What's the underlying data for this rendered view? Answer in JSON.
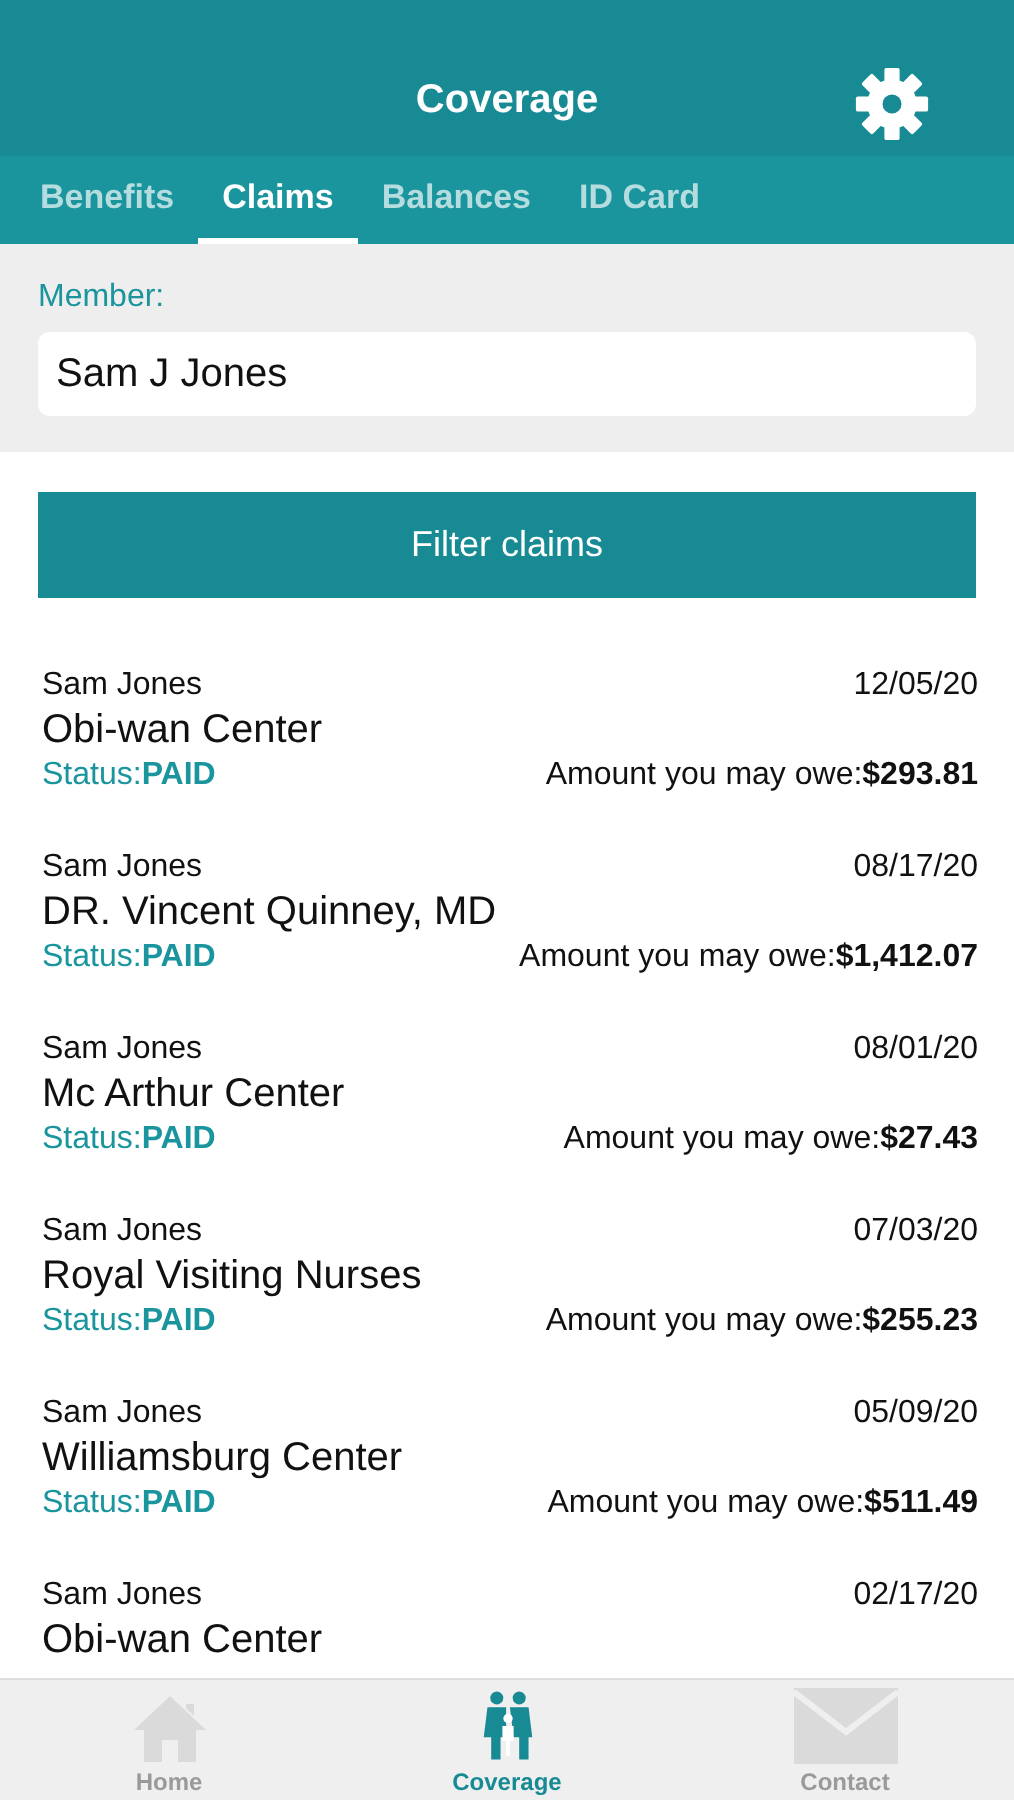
{
  "header": {
    "title": "Coverage"
  },
  "tabs": [
    {
      "label": "Benefits",
      "selected": false
    },
    {
      "label": "Claims",
      "selected": true
    },
    {
      "label": "Balances",
      "selected": false
    },
    {
      "label": "ID Card",
      "selected": false
    }
  ],
  "member": {
    "label": "Member:",
    "value": "Sam J Jones"
  },
  "filter_button": "Filter claims",
  "claims": [
    {
      "member": "Sam Jones",
      "date": "12/05/20",
      "provider": "Obi-wan Center",
      "status": "Status:**PAID**",
      "amount": "Amount you may owe:**$293.81**"
    },
    {
      "member": "Sam Jones",
      "date": "08/17/20",
      "provider": "DR. Vincent Quinney, MD",
      "status": "Status:**PAID**",
      "amount": "Amount you may owe:**$1,412.07**"
    },
    {
      "member": "Sam Jones",
      "date": "08/01/20",
      "provider": "Mc Arthur Center",
      "status": "Status:**PAID**",
      "amount": "Amount you may owe:**$27.43**"
    },
    {
      "member": "Sam Jones",
      "date": "07/03/20",
      "provider": "Royal Visiting Nurses",
      "status": "Status:**PAID**",
      "amount": "Amount you may owe:**$255.23**"
    },
    {
      "member": "Sam Jones",
      "date": "05/09/20",
      "provider": "Williamsburg Center",
      "status": "Status:**PAID**",
      "amount": "Amount you may owe:**$511.49**"
    },
    {
      "member": "Sam Jones",
      "date": "02/17/20",
      "provider": "Obi-wan Center"
    }
  ],
  "bottom_tabs": [
    {
      "label": "Home",
      "kind": "home",
      "selected": false
    },
    {
      "label": "Coverage",
      "kind": "family",
      "selected": true
    },
    {
      "label": "Contact",
      "kind": "mail",
      "selected": false
    }
  ]
}
